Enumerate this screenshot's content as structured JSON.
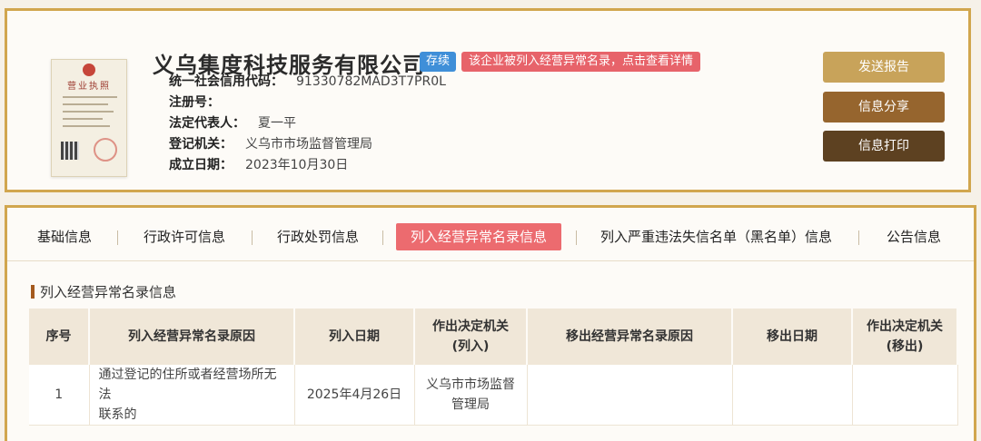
{
  "company": {
    "name": "义乌集度科技服务有限公司",
    "status_badge": "存续",
    "warning_badge": "该企业被列入经营异常名录，点击查看详情",
    "license_title": "营业执照",
    "fields": [
      {
        "label": "统一社会信用代码：",
        "value": "91330782MAD3T7PR0L"
      },
      {
        "label": "注册号：",
        "value": ""
      },
      {
        "label": "法定代表人：",
        "value": "夏一平"
      },
      {
        "label": "登记机关：",
        "value": "义乌市市场监督管理局"
      },
      {
        "label": "成立日期：",
        "value": "2023年10月30日"
      }
    ]
  },
  "actions": {
    "send_report": "发送报告",
    "share_info": "信息分享",
    "print_info": "信息打印"
  },
  "tabs": [
    {
      "label": "基础信息",
      "active": false
    },
    {
      "label": "行政许可信息",
      "active": false
    },
    {
      "label": "行政处罚信息",
      "active": false
    },
    {
      "label": "列入经营异常名录信息",
      "active": true
    },
    {
      "label": "列入严重违法失信名单（黑名单）信息",
      "active": false
    },
    {
      "label": "公告信息",
      "active": false
    }
  ],
  "section": {
    "title": "列入经营异常名录信息"
  },
  "table": {
    "columns": [
      {
        "line1": "序号",
        "line2": ""
      },
      {
        "line1": "列入经营异常名录原因",
        "line2": ""
      },
      {
        "line1": "列入日期",
        "line2": ""
      },
      {
        "line1": "作出决定机关",
        "line2": "(列入)"
      },
      {
        "line1": "移出经营异常名录原因",
        "line2": ""
      },
      {
        "line1": "移出日期",
        "line2": ""
      },
      {
        "line1": "作出决定机关",
        "line2": "(移出)"
      }
    ],
    "rows": [
      {
        "index": "1",
        "reason_line1": "通过登记的住所或者经营场所无法",
        "reason_line2": "联系的",
        "date": "2025年4月26日",
        "authority_line1": "义乌市市场监督",
        "authority_line2": "管理局",
        "removal_reason": "",
        "removal_date": "",
        "removal_authority": ""
      }
    ]
  },
  "colors": {
    "accent_gold": "#d1a64e",
    "status_blue": "#3f8fd8",
    "warning_red": "#e7636a",
    "active_tab": "#ec6b6f"
  }
}
